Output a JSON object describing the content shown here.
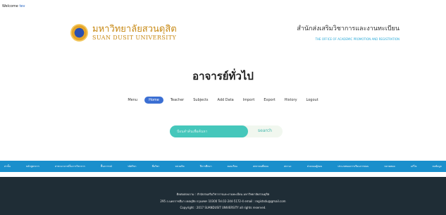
{
  "header": {
    "welcome_prefix": "Welcome",
    "welcome_user": "tev",
    "brand_th": "มหาวิทยาลัยสวนดุสิต",
    "brand_en": "SUAN DUSIT UNIVERSITY",
    "office_th": "สำนักส่งเสริมวิชาการและงานทะเบียน",
    "office_en": "THE OFFICE OF ACADEMIC PROMOTION AND REGISTRATION"
  },
  "page": {
    "title": "อาจารย์ทั่วไป"
  },
  "nav": {
    "items": [
      "Menu",
      "Home",
      "Teacher",
      "Subjects",
      "Add Data",
      "Import",
      "Export",
      "History",
      "Logout"
    ],
    "active": "Home"
  },
  "search": {
    "placeholder": "ป้อนคำค้นเพื่อค้นหา",
    "button": "search"
  },
  "categories": [
    "สาขั้น",
    "หลักสูตรการ",
    "สาขาอาจารย์ในการวิชาการ",
    "ฟื้นการรณ์",
    "รลัศวิชา",
    "ชื่อวิชา",
    "หน่วยกิต",
    "ปีการศึกษา",
    "ตอนเรียน",
    "สตราคนที่สอน",
    "สถานะ",
    "ส่วนของผู้สอน",
    "ประเภทของการเรียนการสอน",
    "หลายหมด",
    "แก้ไข",
    "ลบข้อมูล"
  ],
  "footer": {
    "line1": "ติดต่อสอบถาม : สำนักส่งเสริมวิชาการและงานทะเบียน มหาวิทยาลัยสวนดุสิต",
    "line2": "295 ถ.นครราชสีมา เขตดุสิต กรุงเทพฯ 10300 Tel.02-244-5172-4 email : registsdu@gmail.com",
    "line3": "Copyright : 2017 SUANDUSIT UNIVERSITY all rights reserved."
  }
}
